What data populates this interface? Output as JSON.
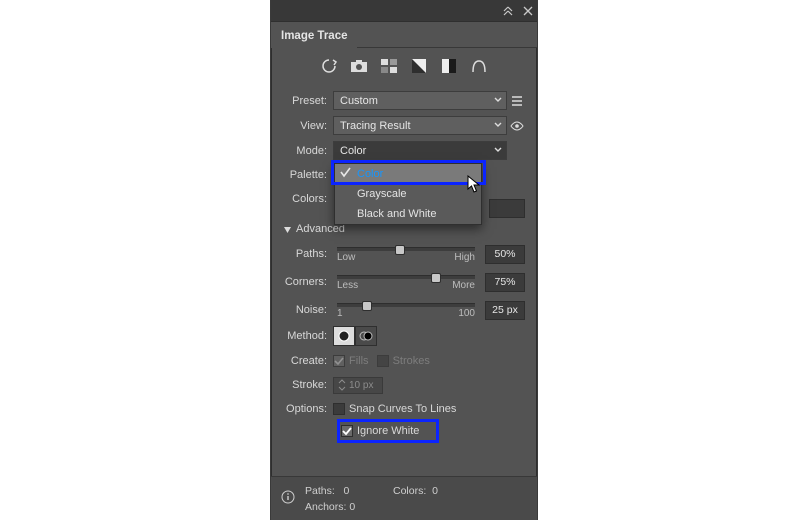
{
  "panel": {
    "title": "Image Trace"
  },
  "preset_icons": [
    "auto",
    "camera",
    "artwork",
    "grayscale",
    "bw",
    "bw-logo",
    "tech"
  ],
  "rows": {
    "preset": {
      "label": "Preset:",
      "value": "Custom"
    },
    "view": {
      "label": "View:",
      "value": "Tracing Result"
    },
    "mode": {
      "label": "Mode:",
      "value": "Color"
    },
    "palette": {
      "label": "Palette:"
    },
    "colors": {
      "label": "Colors:"
    }
  },
  "mode_dropdown": {
    "items": [
      "Color",
      "Grayscale",
      "Black and White"
    ],
    "selected": 0
  },
  "advanced": {
    "label": "Advanced",
    "paths": {
      "label": "Paths:",
      "low": "Low",
      "high": "High",
      "value": "50%",
      "pos": 46
    },
    "corners": {
      "label": "Corners:",
      "low": "Less",
      "high": "More",
      "value": "75%",
      "pos": 72
    },
    "noise": {
      "label": "Noise:",
      "low": "1",
      "high": "100",
      "value": "25 px",
      "pos": 22
    },
    "method": {
      "label": "Method:"
    },
    "create": {
      "label": "Create:",
      "fills": "Fills",
      "strokes": "Strokes"
    },
    "stroke": {
      "label": "Stroke:",
      "value": "10 px"
    },
    "options": {
      "label": "Options:",
      "snap": "Snap Curves To Lines",
      "ignore": "Ignore White"
    }
  },
  "footer": {
    "paths": {
      "label": "Paths:",
      "value": "0"
    },
    "colors": {
      "label": "Colors:",
      "value": "0"
    },
    "anchors": {
      "label": "Anchors:",
      "value": "0"
    }
  }
}
